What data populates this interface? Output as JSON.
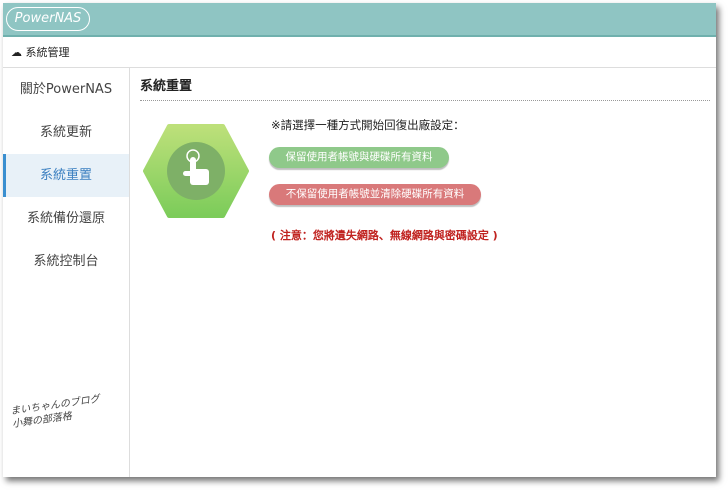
{
  "header": {
    "logo": "PowerNAS"
  },
  "breadcrumb": {
    "label": "系統管理"
  },
  "sidebar": {
    "items": [
      {
        "label": "關於PowerNAS"
      },
      {
        "label": "系統更新"
      },
      {
        "label": "系統重置",
        "active": true
      },
      {
        "label": "系統備份還原"
      },
      {
        "label": "系統控制台"
      }
    ]
  },
  "main": {
    "title": "系統重置",
    "prompt": "※請選擇一種方式開始回復出廠設定：",
    "keep_button": "保留使用者帳號與硬碟所有資料",
    "wipe_button": "不保留使用者帳號並清除硬碟所有資料",
    "note": "( 注意：您將遺失網路、無線網路與密碼設定 )"
  },
  "watermark": {
    "line1": "まいちゃんのブログ",
    "line2": "小舞の部落格"
  },
  "colors": {
    "header": "#8fc5c3",
    "keep": "#8fc98a",
    "wipe": "#d9797a",
    "note": "#c0221f",
    "active": "#3a7fc0"
  }
}
